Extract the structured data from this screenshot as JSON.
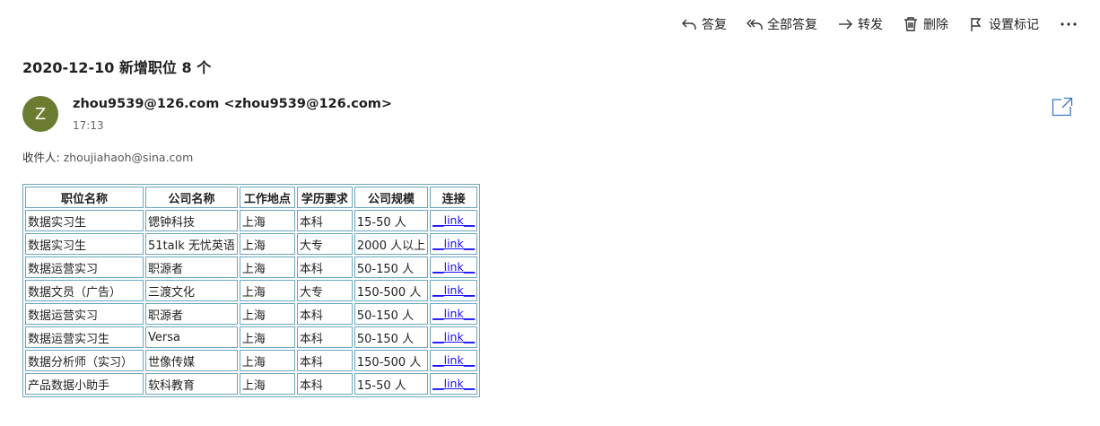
{
  "toolbar": {
    "reply": "答复",
    "reply_all": "全部答复",
    "forward": "转发",
    "delete": "删除",
    "flag": "设置标记"
  },
  "message": {
    "subject": "2020-12-10 新增职位 8 个",
    "avatar_initial": "Z",
    "avatar_color": "#6b7c30",
    "sender": "zhou9539@126.com <zhou9539@126.com>",
    "time": "17:13",
    "to_label": "收件人:",
    "to_address": "zhoujiahaoh@sina.com"
  },
  "table": {
    "headers": [
      "职位名称",
      "公司名称",
      "工作地点",
      "学历要求",
      "公司规模",
      "连接"
    ],
    "rows": [
      [
        "数据实习生",
        "锶钟科技",
        "上海",
        "本科",
        "15-50 人",
        "__link__"
      ],
      [
        "数据实习生",
        "51talk 无忧英语",
        "上海",
        "大专",
        "2000 人以上",
        "__link__"
      ],
      [
        "数据运营实习",
        "职源者",
        "上海",
        "本科",
        "50-150 人",
        "__link__"
      ],
      [
        "数据文员（广告）",
        "三渡文化",
        "上海",
        "大专",
        "150-500 人",
        "__link__"
      ],
      [
        "数据运营实习",
        "职源者",
        "上海",
        "本科",
        "50-150 人",
        "__link__"
      ],
      [
        "数据运营实习生",
        "Versa",
        "上海",
        "本科",
        "50-150 人",
        "__link__"
      ],
      [
        "数据分析师（实习）",
        "世像传媒",
        "上海",
        "本科",
        "150-500 人",
        "__link__"
      ],
      [
        "产品数据小助手",
        "软科教育",
        "上海",
        "本科",
        "15-50 人",
        "__link__"
      ]
    ]
  }
}
